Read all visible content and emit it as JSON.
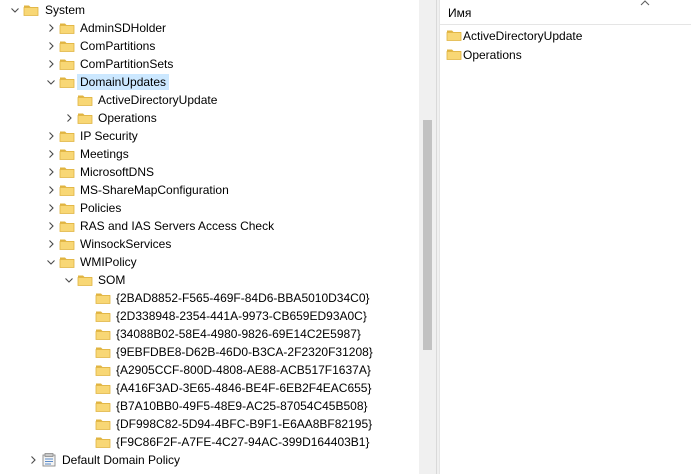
{
  "colors": {
    "selection": "#cce8ff",
    "folder": "#f8d775",
    "folder_dark": "#e0b441",
    "pane_bg": "#ffffff",
    "scrollbar_track": "#f0f0f0",
    "scrollbar_thumb": "#c2c2c2"
  },
  "tree": {
    "items": [
      {
        "label": "System",
        "depth": 0,
        "state": "expanded",
        "icon": "folder-icon",
        "selected": false
      },
      {
        "label": "AdminSDHolder",
        "depth": 1,
        "state": "collapsed",
        "icon": "folder-icon",
        "selected": false
      },
      {
        "label": "ComPartitions",
        "depth": 1,
        "state": "collapsed",
        "icon": "folder-icon",
        "selected": false
      },
      {
        "label": "ComPartitionSets",
        "depth": 1,
        "state": "collapsed",
        "icon": "folder-icon",
        "selected": false
      },
      {
        "label": "DomainUpdates",
        "depth": 1,
        "state": "expanded",
        "icon": "folder-icon",
        "selected": true
      },
      {
        "label": "ActiveDirectoryUpdate",
        "depth": 2,
        "state": "none",
        "icon": "folder-icon",
        "selected": false
      },
      {
        "label": "Operations",
        "depth": 2,
        "state": "collapsed",
        "icon": "folder-icon",
        "selected": false
      },
      {
        "label": "IP Security",
        "depth": 1,
        "state": "collapsed",
        "icon": "folder-icon",
        "selected": false
      },
      {
        "label": "Meetings",
        "depth": 1,
        "state": "collapsed",
        "icon": "folder-icon",
        "selected": false
      },
      {
        "label": "MicrosoftDNS",
        "depth": 1,
        "state": "collapsed",
        "icon": "folder-icon",
        "selected": false
      },
      {
        "label": "MS-ShareMapConfiguration",
        "depth": 1,
        "state": "collapsed",
        "icon": "folder-icon",
        "selected": false
      },
      {
        "label": "Policies",
        "depth": 1,
        "state": "collapsed",
        "icon": "folder-icon",
        "selected": false
      },
      {
        "label": "RAS and IAS Servers Access Check",
        "depth": 1,
        "state": "collapsed",
        "icon": "folder-icon",
        "selected": false
      },
      {
        "label": "WinsockServices",
        "depth": 1,
        "state": "collapsed",
        "icon": "folder-icon",
        "selected": false
      },
      {
        "label": "WMIPolicy",
        "depth": 1,
        "state": "expanded",
        "icon": "folder-icon",
        "selected": false
      },
      {
        "label": "SOM",
        "depth": 2,
        "state": "expanded",
        "icon": "folder-icon",
        "selected": false
      },
      {
        "label": "{2BAD8852-F565-469F-84D6-BBA5010D34C0}",
        "depth": 3,
        "state": "none",
        "icon": "folder-icon",
        "selected": false
      },
      {
        "label": "{2D338948-2354-441A-9973-CB659ED93A0C}",
        "depth": 3,
        "state": "none",
        "icon": "folder-icon",
        "selected": false
      },
      {
        "label": "{34088B02-58E4-4980-9826-69E14C2E5987}",
        "depth": 3,
        "state": "none",
        "icon": "folder-icon",
        "selected": false
      },
      {
        "label": "{9EBFDBE8-D62B-46D0-B3CA-2F2320F31208}",
        "depth": 3,
        "state": "none",
        "icon": "folder-icon",
        "selected": false
      },
      {
        "label": "{A2905CCF-800D-4808-AE88-ACB517F1637A}",
        "depth": 3,
        "state": "none",
        "icon": "folder-icon",
        "selected": false
      },
      {
        "label": "{A416F3AD-3E65-4846-BE4F-6EB2F4EAC655}",
        "depth": 3,
        "state": "none",
        "icon": "folder-icon",
        "selected": false
      },
      {
        "label": "{B7A10BB0-49F5-48E9-AC25-87054C45B508}",
        "depth": 3,
        "state": "none",
        "icon": "folder-icon",
        "selected": false
      },
      {
        "label": "{DF998C82-5D94-4BFC-B9F1-E6AA8BF82195}",
        "depth": 3,
        "state": "none",
        "icon": "folder-icon",
        "selected": false
      },
      {
        "label": "{F9C86F2F-A7FE-4C27-94AC-399D164403B1}",
        "depth": 3,
        "state": "none",
        "icon": "folder-icon",
        "selected": false
      },
      {
        "label": "Default Domain Policy",
        "depth": 0,
        "state": "collapsed",
        "icon": "policy-container-icon",
        "selected": false
      }
    ]
  },
  "list": {
    "column_header": "Имя",
    "sort_icon": "sort-ascending-icon",
    "items": [
      {
        "label": "ActiveDirectoryUpdate",
        "icon": "folder-icon"
      },
      {
        "label": "Operations",
        "icon": "folder-icon"
      }
    ]
  }
}
